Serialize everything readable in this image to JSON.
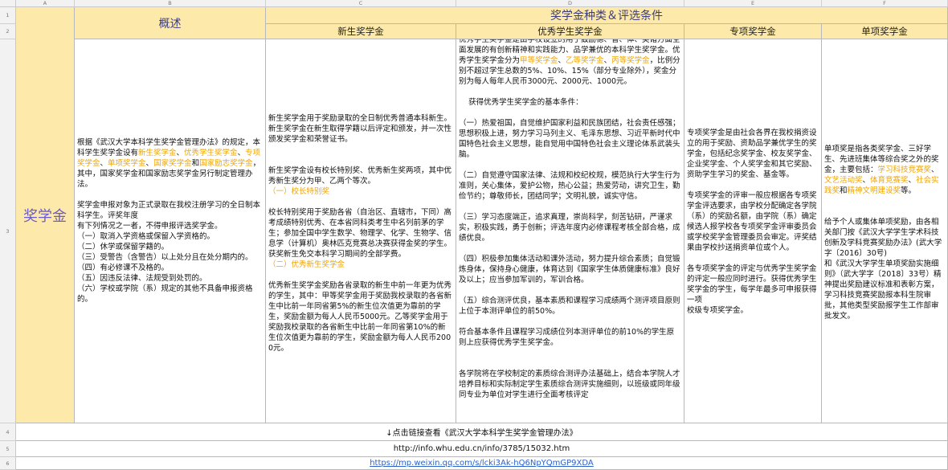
{
  "columns": [
    "A",
    "B",
    "C",
    "D",
    "E",
    "F"
  ],
  "rows": [
    "1",
    "2",
    "3",
    "4",
    "5",
    "6"
  ],
  "header": {
    "overview": "概述",
    "group_title": "奖学金种类＆评选条件",
    "sub": [
      "新生奖学金",
      "优秀学生奖学金",
      "专项奖学金",
      "单项奖学金"
    ]
  },
  "main_label": "奖学金",
  "overview": {
    "p1a": "根据《武汉大学本科学生奖学金管理办法》的规定，本科学生奖学金设有",
    "hl1": "新生奖学金",
    "sep1": "、",
    "hl2": "优秀学生奖学金",
    "sep2": "、",
    "hl3": "专项奖学金",
    "sep3": "、",
    "hl4": "单项奖学金",
    "sep4": "、",
    "hl5": "国家奖学金",
    "and": "和",
    "hl6": "国家励志奖学金",
    "p1b": "，其中，国家奖学金和国家励志奖学金另行制定管理办法。",
    "p2": "奖学金申报对象为正式录取在我校注册学习的全日制本科学生。评奖年度\n有下列情况之一者，不得申报评选奖学金。\n（一）取消入学资格或保留入学资格的。\n（二）休学或保留学籍的。\n（三）受警告（含警告）以上处分且在处分期内的。\n（四）有必修课不及格的。\n（五）因违反法律、法规受到处罚的。\n（六）学校或学院（系）规定的其他不具备申报资格的。"
  },
  "freshman": {
    "p1": "新生奖学金用于奖励录取的全日制优秀普通本科新生。新生奖学金在新生取得学籍以后评定和颁发，并一次性颁发奖学金和荣誉证书。",
    "p2": "新生奖学金设有校长特别奖、优秀新生奖两项，其中优秀新生奖分为甲、乙两个等次。",
    "h1": "（一）校长特别奖",
    "p3": "校长特别奖用于奖励各省（自治区、直辖市，下同）高考成绩特别优秀、在本省同科类考生中名列前茅的学生；参加全国中学生数学、物理学、化学、生物学、信息学（计算机）奥林匹克竞赛总决赛获得金奖的学生。获奖新生免交本科学习期间的全部学费。",
    "h2": "（二）优秀新生奖学金",
    "p4": "优秀新生奖学金奖励各省录取的新生中前一年更为优秀的学生，其中：甲等奖学金用于奖励我校录取的各省新生中比前一年同省第5%的新生位次值更为靠前的学生，奖励金额为每人人民币5000元。乙等奖学金用于奖励我校录取的各省新生中比前一年同省第10%的新生位次值更为靠前的学生，奖励金额为每人人民币2000元。"
  },
  "excellent": {
    "p1a": "优秀学生奖学金是由学校设立的用于鼓励德、智、体、美诸方面全面发展的有创新精神和实践能力、品学兼优的本科学生奖学金。优秀学生奖学金分为",
    "hlA": "甲等奖学金",
    "sepA": "、",
    "hlB": "乙等奖学金",
    "sepB": "、",
    "hlC": "丙等奖学金",
    "p1b": "，比例分别不超过学生总数的5%、10%、15%（部分专业除外），奖金分别为每人每年人民币3000元、2000元、1000元。",
    "p2": "    获得优秀学生奖学金的基本条件：",
    "p3": "（一）热爱祖国，自觉维护国家利益和民族团结，社会责任感强；思想积极上进，努力学习马列主义、毛泽东思想、习近平新时代中国特色社会主义思想，能自觉用中国特色社会主义理论体系武装头脑。",
    "p4": "（二）自觉遵守国家法律、法规和校纪校规，模范执行大学生行为准则，关心集体，爱护公物，热心公益；热爱劳动，讲究卫生，勤俭节约；尊敬师长，团结同学；文明礼貌，诚实守信。",
    "p5": "（三）学习态度端正，追求真理，崇尚科学，刻苦钻研，严谨求实，积极实践，勇于创新；评选年度内必修课程考核全部合格，成绩优良。",
    "p6": "（四）积极参加集体活动和课外活动，努力提升综合素质；自觉锻炼身体，保持身心健康，体育达到《国家学生体质健康标准》良好及以上；应当参加军训的，军训合格。",
    "p7": "（五）综合测评优良，基本素质和课程学习成绩两个测评项目原则上位于本测评单位的前50%。",
    "p8": "符合基本条件且课程学习成绩位列本测评单位的前10%的学生原则上应获得优秀学生奖学金。",
    "p9": "各学院将在学校制定的素质综合测评办法基础上，结合本学院人才培养目标和实际制定学生素质综合测评实施细则，以班级或同年级同专业为单位对学生进行全面考核评定"
  },
  "special": {
    "p1": "专项奖学金是由社会各界在我校捐资设立的用于奖励、资助品学兼优学生的奖学金，包括纪念奖学金、校友奖学金、企业奖学金、个人奖学金和其它奖励、资助学生学习的奖金、基金等。",
    "p2": "专项奖学金的评审一般应根据各专项奖学金评选要求，由学校分配确定各学院（系）的奖励名额，由学院（系）确定候选人报学校各专项奖学金评审委员会或学校奖学金管理委员会审定。评奖结果由学校抄送捐资单位或个人。",
    "p3": "各专项奖学金的评定与优秀学生奖学金的评定一般应同时进行。获得优秀学生奖学金的学生，每学年最多可申报获得一项\n校级专项奖学金。"
  },
  "single": {
    "p1a": "单项奖是指各类奖学金、三好学生、先进班集体等综合奖之外的奖金，主要包括：",
    "hl1": "学习科技竞赛奖",
    "sep1": "、",
    "hl2": "文艺活动奖",
    "sep2": "、",
    "hl3": "体育竞赛奖",
    "sep3": "、",
    "hl4": "社会实践奖",
    "and": "和",
    "hl5": "精神文明建设奖",
    "p1b": "等。",
    "p2": "给予个人或集体单项奖励，由各相关部门按《武汉大学学生学术科技创新及学科竞赛奖励办法》(武大学字〔2016〕30号)\n和《武汉大学学生单项奖励实施细则》（武大学字〔2018〕33号）精神提出奖励建议标准和表彰方案，学习科技竞赛奖励报本科生院审批，其他类型奖励报学生工作部审批发文。"
  },
  "links": {
    "hint": "↓点击链接查看《武汉大学本科学生奖学金管理办法》",
    "url1": "http://info.whu.edu.cn/info/3785/15032.htm",
    "url2": "https://mp.weixin.qq.com/s/lcki3Ak-hQ6NpYQmGP9XDA"
  }
}
